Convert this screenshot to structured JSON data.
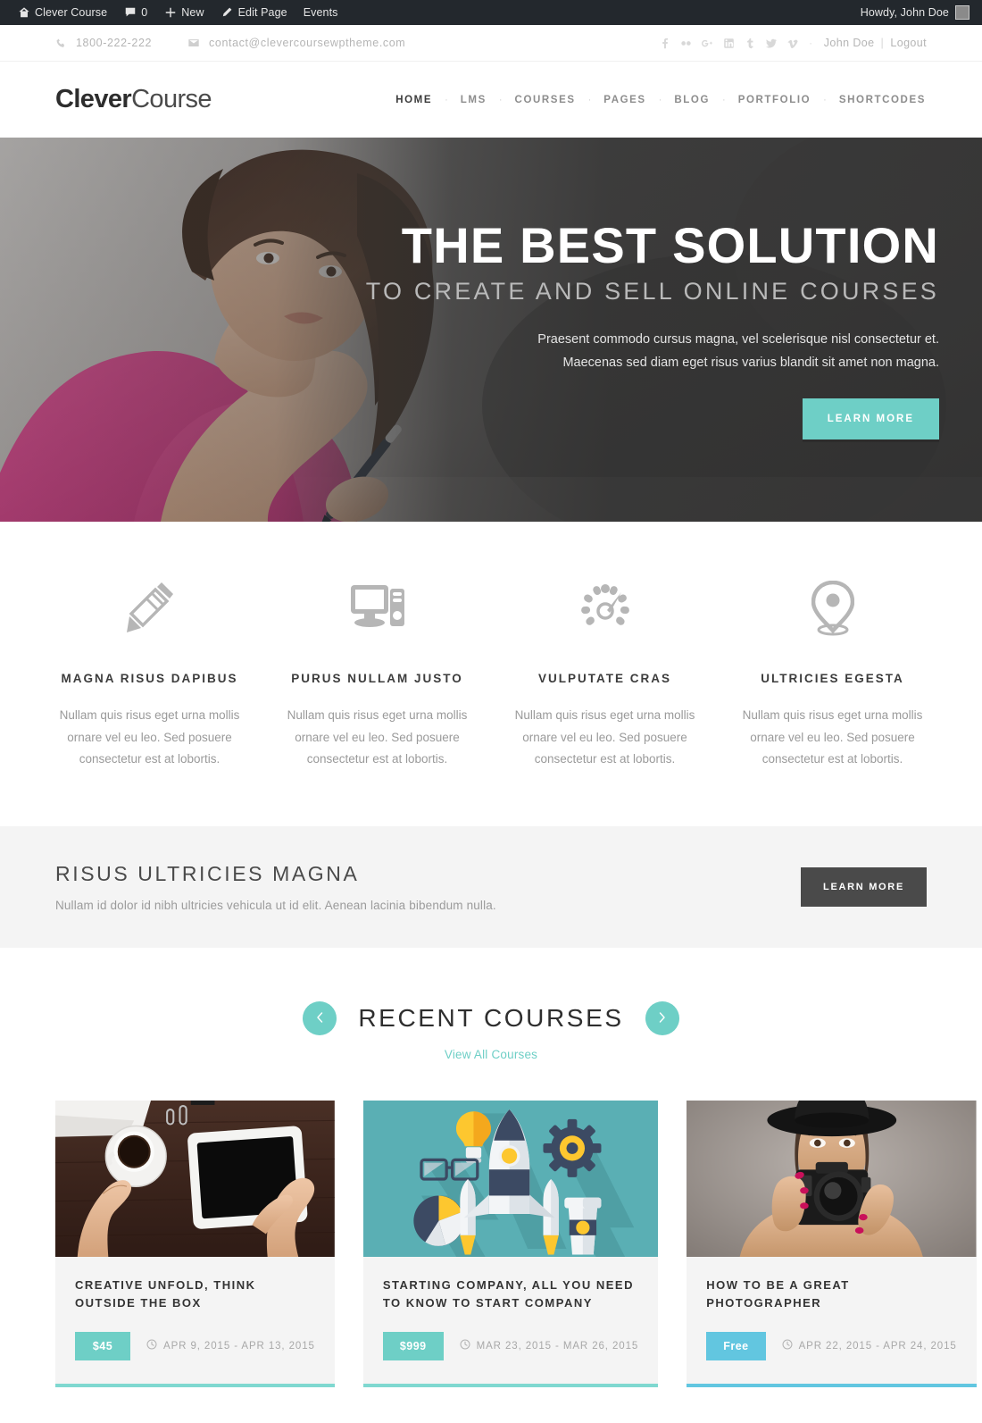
{
  "adminbar": {
    "site_icon": "home-icon",
    "site_name": "Clever Course",
    "comments_icon": "comment-bubble-icon",
    "comments_count": "0",
    "new_icon": "plus-icon",
    "new_label": "New",
    "edit_icon": "pencil-icon",
    "edit_label": "Edit Page",
    "events_label": "Events",
    "howdy": "Howdy, John Doe",
    "avatar": "user-avatar"
  },
  "topbar": {
    "phone_icon": "phone-icon",
    "phone": "1800-222-222",
    "email_icon": "envelope-icon",
    "email": "contact@clevercoursewptheme.com",
    "social": [
      {
        "name": "facebook-icon",
        "glyph": "f"
      },
      {
        "name": "flickr-icon",
        "glyph": "••"
      },
      {
        "name": "google-plus-icon",
        "glyph": "g+"
      },
      {
        "name": "linkedin-icon",
        "glyph": "in"
      },
      {
        "name": "tumblr-icon",
        "glyph": "t"
      },
      {
        "name": "twitter-icon",
        "glyph": "tw"
      },
      {
        "name": "vimeo-icon",
        "glyph": "V"
      }
    ],
    "separator": "·",
    "user": "John Doe",
    "pipe": "|",
    "logout": "Logout"
  },
  "header": {
    "logo_bold": "Clever",
    "logo_light": "Course",
    "nav": [
      {
        "label": "HOME",
        "active": true
      },
      {
        "label": "LMS",
        "active": false
      },
      {
        "label": "COURSES",
        "active": false
      },
      {
        "label": "PAGES",
        "active": false
      },
      {
        "label": "BLOG",
        "active": false
      },
      {
        "label": "PORTFOLIO",
        "active": false
      },
      {
        "label": "SHORTCODES",
        "active": false
      }
    ],
    "nav_dot": "·"
  },
  "hero": {
    "title": "THE BEST SOLUTION",
    "subtitle": "TO CREATE AND SELL ONLINE COURSES",
    "paragraph": "Praesent commodo cursus magna, vel scelerisque nisl consectetur et. Maecenas sed diam eget risus varius blandit sit amet non magna.",
    "button": "LEARN MORE",
    "button_color": "#6ECFC6"
  },
  "features": [
    {
      "icon": "pencil-icon",
      "title": "MAGNA RISUS DAPIBUS",
      "text": "Nullam quis risus eget urna mollis ornare vel eu leo. Sed posuere consectetur est at lobortis."
    },
    {
      "icon": "desktop-computer-icon",
      "title": "PURUS NULLAM JUSTO",
      "text": "Nullam quis risus eget urna mollis ornare vel eu leo. Sed posuere consectetur est at lobortis."
    },
    {
      "icon": "speedometer-icon",
      "title": "VULPUTATE CRAS",
      "text": "Nullam quis risus eget urna mollis ornare vel eu leo. Sed posuere consectetur est at lobortis."
    },
    {
      "icon": "map-pin-icon",
      "title": "ULTRICIES EGESTA",
      "text": "Nullam quis risus eget urna mollis ornare vel eu leo. Sed posuere consectetur est at lobortis."
    }
  ],
  "cta": {
    "title": "RISUS ULTRICIES MAGNA",
    "text": "Nullam id dolor id nibh ultricies vehicula ut id elit. Aenean lacinia bibendum nulla.",
    "button": "LEARN MORE"
  },
  "courses_section": {
    "prev_icon": "chevron-left-icon",
    "next_icon": "chevron-right-icon",
    "title": "RECENT COURSES",
    "view_all": "View All Courses"
  },
  "courses": [
    {
      "image": "coffee-tablet-desk-photo",
      "title": "CREATIVE UNFOLD, THINK OUTSIDE THE BOX",
      "price": "$45",
      "price_color": "#6ECFC6",
      "clock_icon": "clock-icon",
      "dates": "APR 9, 2015 - APR 13, 2015",
      "accent": "#7FD8D0"
    },
    {
      "image": "rocket-startup-illustration",
      "title": "STARTING COMPANY, ALL YOU NEED TO KNOW TO START COMPANY",
      "price": "$999",
      "price_color": "#6ECFC6",
      "clock_icon": "clock-icon",
      "dates": "MAR 23, 2015 - MAR 26, 2015",
      "accent": "#7FD8D0"
    },
    {
      "image": "photographer-woman-camera-photo",
      "title": "HOW TO BE A GREAT PHOTOGRAPHER",
      "price": "Free",
      "price_color": "#62C6E0",
      "clock_icon": "clock-icon",
      "dates": "APR 22, 2015 - APR 24, 2015",
      "accent": "#62C6E0"
    }
  ]
}
